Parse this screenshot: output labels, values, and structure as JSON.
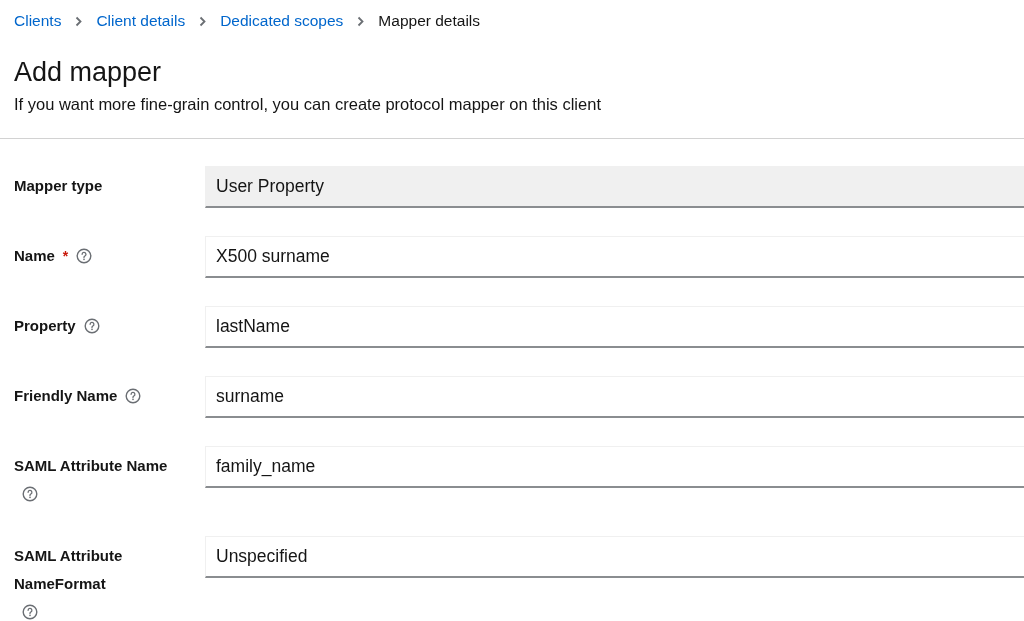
{
  "breadcrumb": [
    {
      "label": "Clients",
      "link": true
    },
    {
      "label": "Client details",
      "link": true
    },
    {
      "label": "Dedicated scopes",
      "link": true
    },
    {
      "label": "Mapper details",
      "link": false
    }
  ],
  "title": "Add mapper",
  "required_marker": "*",
  "description": "If you want more fine-grain control, you can create protocol mapper on this client",
  "fields": [
    {
      "label": "Mapper type",
      "required": false,
      "help": false,
      "disabled": true,
      "value": "User Property"
    },
    {
      "label": "Name",
      "required": true,
      "help": true,
      "disabled": false,
      "value": "X500 surname"
    },
    {
      "label": "Property",
      "required": false,
      "help": true,
      "disabled": false,
      "value": "lastName"
    },
    {
      "label": "Friendly Name",
      "required": false,
      "help": true,
      "disabled": false,
      "value": "surname"
    },
    {
      "label": "SAML Attribute Name",
      "required": false,
      "help": true,
      "disabled": false,
      "value": "family_name"
    },
    {
      "label": "SAML Attribute NameFormat",
      "required": false,
      "help": true,
      "disabled": false,
      "value": "Unspecified"
    }
  ]
}
